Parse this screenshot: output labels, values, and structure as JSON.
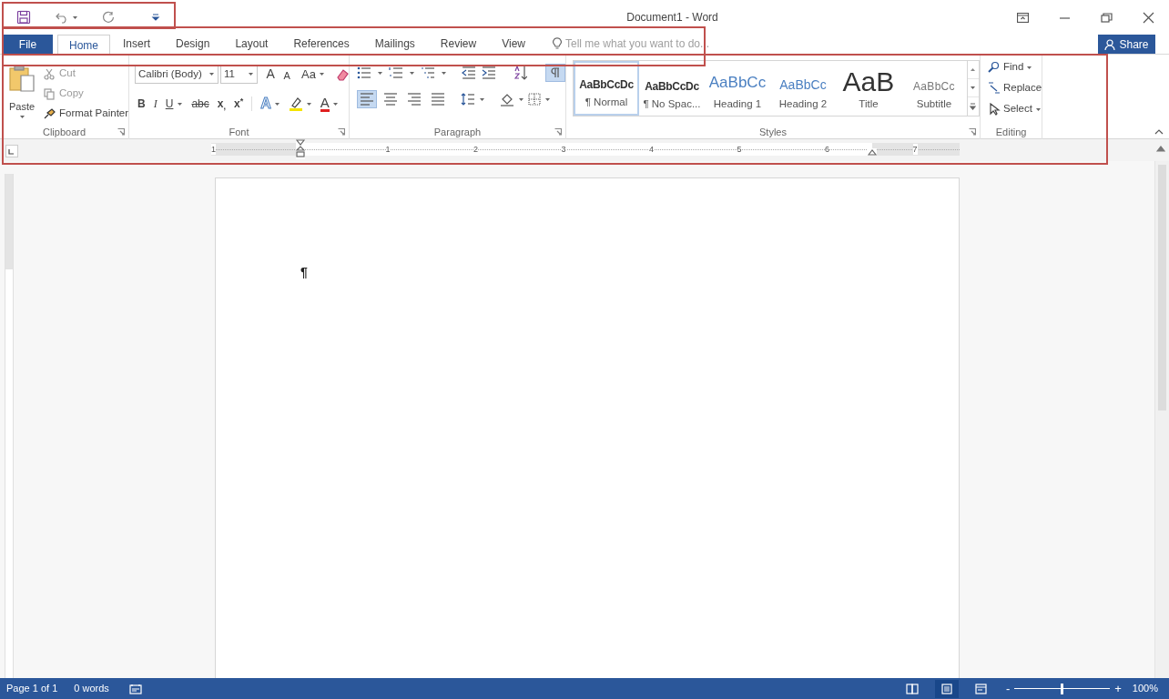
{
  "window": {
    "title": "Document1 - Word"
  },
  "tabs": [
    {
      "label": "File",
      "kind": "file",
      "selected": false
    },
    {
      "label": "Home",
      "kind": "tab",
      "selected": true
    },
    {
      "label": "Insert",
      "kind": "tab",
      "selected": false
    },
    {
      "label": "Design",
      "kind": "tab",
      "selected": false
    },
    {
      "label": "Layout",
      "kind": "tab",
      "selected": false
    },
    {
      "label": "References",
      "kind": "tab",
      "selected": false
    },
    {
      "label": "Mailings",
      "kind": "tab",
      "selected": false
    },
    {
      "label": "Review",
      "kind": "tab",
      "selected": false
    },
    {
      "label": "View",
      "kind": "tab",
      "selected": false
    }
  ],
  "tell_me": {
    "placeholder": "Tell me what you want to do..."
  },
  "share": "Share",
  "clipboard": {
    "label": "Clipboard",
    "paste": "Paste",
    "items": [
      {
        "label": "Cut",
        "kind": "cut",
        "disabled": true
      },
      {
        "label": "Copy",
        "kind": "copy",
        "disabled": true
      },
      {
        "label": "Format Painter",
        "kind": "painter",
        "disabled": false
      }
    ]
  },
  "font": {
    "label": "Font",
    "family": "Calibri (Body)",
    "size": "11",
    "grow": "A",
    "shrink": "A",
    "change_case": "Aa",
    "format_buttons": [
      {
        "label": "B",
        "kind": "bold"
      },
      {
        "label": "I",
        "kind": "italic"
      },
      {
        "label": "U",
        "kind": "underline"
      },
      {
        "label": "abc",
        "kind": "strike"
      },
      {
        "label": "x$_{,}$",
        "kind": "sub"
      },
      {
        "label": "x$^{*}$",
        "kind": "sup"
      }
    ],
    "text_effects": "A",
    "font_color": "A"
  },
  "paragraph": {
    "label": "Paragraph",
    "show_marks": true,
    "alignments": [
      {
        "kind": "left",
        "selected": true
      },
      {
        "kind": "center",
        "selected": false
      },
      {
        "kind": "right",
        "selected": false
      },
      {
        "kind": "justify",
        "selected": false
      }
    ]
  },
  "styles": {
    "label": "Styles",
    "items": [
      {
        "preview": "AaBbCcDc",
        "name": "¶ Normal",
        "kind": "normal",
        "selected": true
      },
      {
        "preview": "AaBbCcDc",
        "name": "¶ No Spac...",
        "kind": "nospacing",
        "selected": false
      },
      {
        "preview": "AaBbCc",
        "name": "Heading 1",
        "kind": "heading1",
        "selected": false
      },
      {
        "preview": "AaBbCc",
        "name": "Heading 2",
        "kind": "heading2",
        "selected": false
      },
      {
        "preview": "AaB",
        "name": "Title",
        "kind": "title",
        "selected": false
      },
      {
        "preview": "AaBbCc",
        "name": "Subtitle",
        "kind": "subtitle",
        "selected": false
      }
    ]
  },
  "editing": {
    "label": "Editing",
    "items": [
      {
        "label": "Find",
        "kind": "find"
      },
      {
        "label": "Replace",
        "kind": "replace"
      },
      {
        "label": "Select",
        "kind": "select"
      }
    ]
  },
  "ruler": {
    "numbers": [
      "1",
      "1",
      "2",
      "3",
      "4",
      "5",
      "6",
      "7"
    ]
  },
  "document": {
    "mark": "¶"
  },
  "status_bar": {
    "page": "Page 1 of 1",
    "words": "0 words",
    "views": [
      {
        "kind": "read",
        "selected": false
      },
      {
        "kind": "print",
        "selected": true
      },
      {
        "kind": "web",
        "selected": false
      }
    ],
    "zoom_out": "-",
    "zoom_in": "+",
    "zoom": {
      "level": 0.5
    },
    "zoom_label": "100%"
  }
}
